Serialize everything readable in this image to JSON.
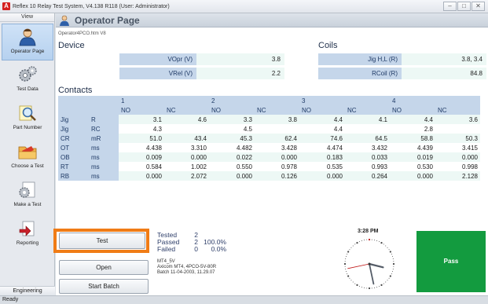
{
  "window": {
    "title": "Reflex 10 Relay Test System, V4.138 R118 (User: Administrator)",
    "btn_min": "‒",
    "btn_max": "□",
    "btn_close": "✕"
  },
  "sidebar": {
    "header": "View",
    "items": [
      {
        "label": "Operator Page",
        "icon": "operator-icon"
      },
      {
        "label": "Test Data",
        "icon": "gears-icon"
      },
      {
        "label": "Part Number",
        "icon": "magnifier-icon"
      },
      {
        "label": "Choose a Test",
        "icon": "folder-icon"
      },
      {
        "label": "Make a Test",
        "icon": "gears-page-icon"
      },
      {
        "label": "Reporting",
        "icon": "report-icon"
      }
    ],
    "footer": "Engineering"
  },
  "page": {
    "title": "Operator Page",
    "filename": "Operator4PCO.htm V8"
  },
  "device": {
    "title": "Device",
    "rows": [
      {
        "label": "VOpr (V)",
        "value": "3.8"
      },
      {
        "label": "VRel (V)",
        "value": "2.2"
      }
    ]
  },
  "coils": {
    "title": "Coils",
    "rows": [
      {
        "label": "Jig H,L (R)",
        "value": "3.8, 3.4"
      },
      {
        "label": "RCoil (R)",
        "value": "84.8"
      }
    ]
  },
  "contacts": {
    "title": "Contacts",
    "groups": [
      "1",
      "2",
      "3",
      "4"
    ],
    "subheaders": [
      "NO",
      "NC",
      "NO",
      "NC",
      "NO",
      "NC",
      "NO",
      "NC"
    ],
    "rows": [
      {
        "name": "Jig",
        "unit": "R",
        "values": [
          "3.1",
          "4.6",
          "3.3",
          "3.8",
          "4.4",
          "4.1",
          "4.4",
          "3.6"
        ]
      },
      {
        "name": "Jig",
        "unit": "RC",
        "values": [
          "4.3",
          "",
          "4.5",
          "",
          "4.4",
          "",
          "2.8",
          ""
        ]
      },
      {
        "name": "CR",
        "unit": "mR",
        "values": [
          "51.0",
          "43.4",
          "45.3",
          "62.4",
          "74.6",
          "64.5",
          "58.8",
          "50.3"
        ]
      },
      {
        "name": "OT",
        "unit": "ms",
        "values": [
          "4.438",
          "3.310",
          "4.482",
          "3.428",
          "4.474",
          "3.432",
          "4.439",
          "3.415"
        ]
      },
      {
        "name": "OB",
        "unit": "ms",
        "values": [
          "0.009",
          "0.000",
          "0.022",
          "0.000",
          "0.183",
          "0.033",
          "0.019",
          "0.000"
        ]
      },
      {
        "name": "RT",
        "unit": "ms",
        "values": [
          "0.584",
          "1.002",
          "0.550",
          "0.978",
          "0.535",
          "0.993",
          "0.530",
          "0.998"
        ]
      },
      {
        "name": "RB",
        "unit": "ms",
        "values": [
          "0.000",
          "2.072",
          "0.000",
          "0.126",
          "0.000",
          "0.264",
          "0.000",
          "2.128"
        ]
      }
    ]
  },
  "controls": {
    "test": "Test",
    "open": "Open",
    "start_batch": "Start Batch"
  },
  "stats": {
    "tested_label": "Tested",
    "tested_count": "2",
    "tested_pct": "",
    "passed_label": "Passed",
    "passed_count": "2",
    "passed_pct": "100.0%",
    "failed_label": "Failed",
    "failed_count": "0",
    "failed_pct": "0.0%"
  },
  "info": {
    "line1": "MT4_5V",
    "line2": "Axicom MT4, 4PCO-5V-80R",
    "line3": "Batch 11-04-2003, 11.29.07"
  },
  "clock": {
    "time": "3:28 PM",
    "hour": 3,
    "minute": 28,
    "second": 43
  },
  "result": {
    "label": "Pass",
    "color": "#139b3f"
  },
  "status": "Ready",
  "colors": {
    "label_bg": "#c5d6ea",
    "value_bg": "#edf8f5",
    "test_highlight": "#f07c16"
  }
}
